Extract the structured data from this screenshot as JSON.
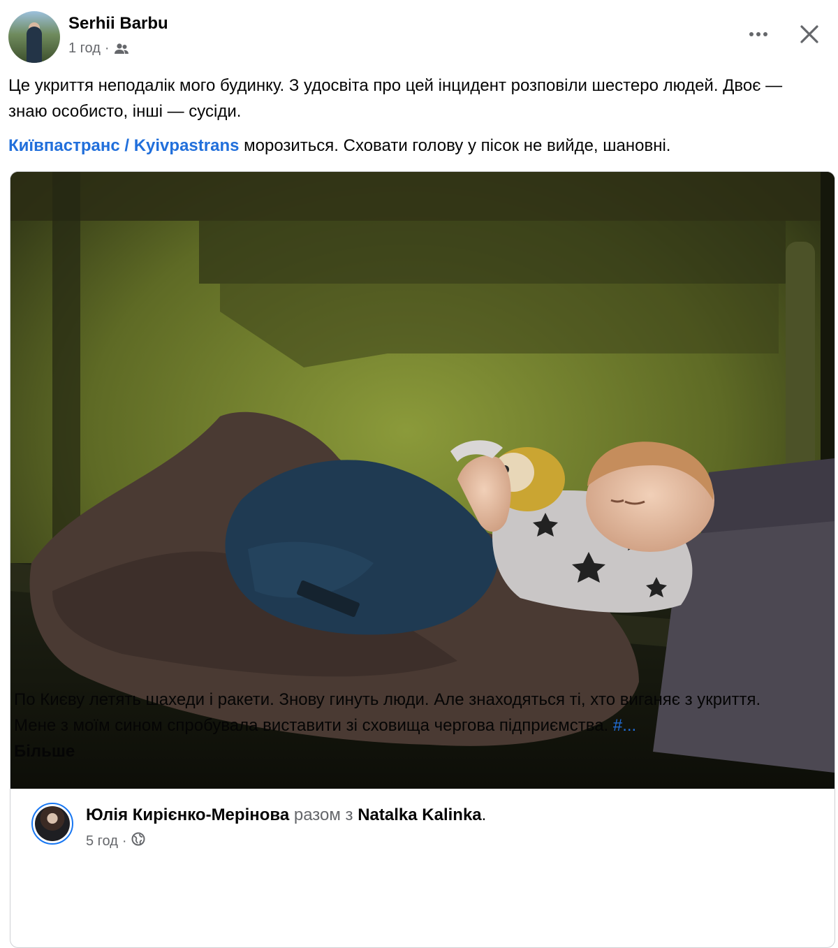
{
  "post": {
    "author": "Serhii Barbu",
    "time": "1 год",
    "separator": "·",
    "audience_icon": "friends-icon",
    "text_line1": "Це укриття неподалік мого будинку. З удосвіта про цей інцидент розповіли шестеро людей. Двоє — знаю особисто, інші — сусіди.",
    "mention": "Київпастранс / Kyivpastrans",
    "text_line2_rest": " морозиться. Сховати голову у пісок не вийде, шановні."
  },
  "shared": {
    "author": "Юлія Кирієнко-Мерінова",
    "with_word": "разом з",
    "tagged": "Natalka Kalinka",
    "period": ".",
    "time": "5 год",
    "separator": "·",
    "audience_icon": "globe-icon",
    "text": "По Києву летять шахеди і ракети. Знову гинуть люди. Але знаходяться ті, хто виганяє з укриття. Мене з моїм сином спробувала виставити зі сховища чергова підприємства. ",
    "hashtag": "#...",
    "see_more": "Більше"
  },
  "colors": {
    "link": "#216fdb",
    "secondary_text": "#65676b",
    "primary_text": "#050505",
    "accent_ring": "#1877f2"
  }
}
